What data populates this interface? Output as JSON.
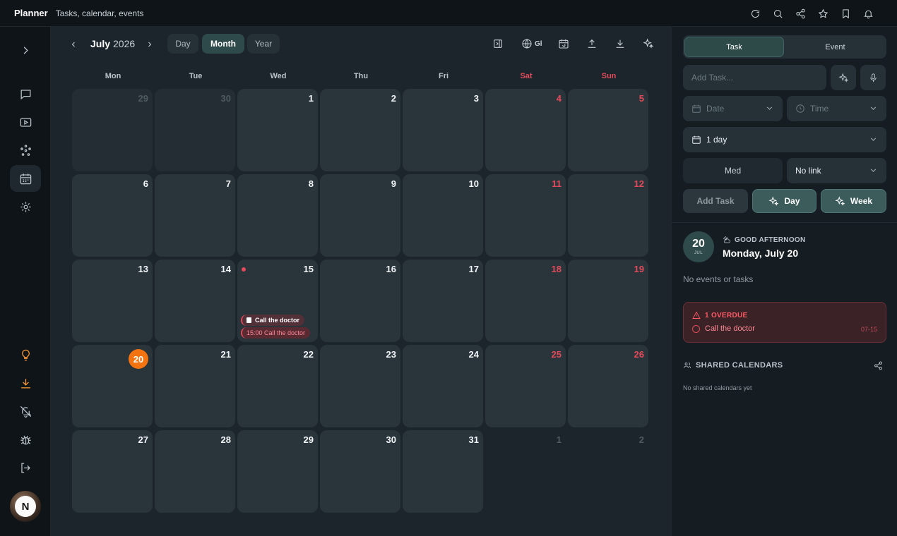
{
  "app": {
    "title": "Planner",
    "subtitle": "Tasks, calendar, events"
  },
  "top_icons": [
    "refresh-icon",
    "search-icon",
    "share-icon",
    "star-icon",
    "bookmark-icon",
    "bell-icon"
  ],
  "sidebar": {
    "items": [
      {
        "name": "expand-icon"
      },
      {
        "name": "chat-icon"
      },
      {
        "name": "video-icon"
      },
      {
        "name": "network-icon"
      },
      {
        "name": "calendar-icon",
        "active": true
      },
      {
        "name": "settings-icon"
      },
      {
        "name": "lightbulb-icon",
        "accent": "#ff9b2f"
      },
      {
        "name": "download-icon",
        "accent": "#ff9b2f"
      },
      {
        "name": "bell-off-icon"
      },
      {
        "name": "bug-icon"
      },
      {
        "name": "logout-icon"
      }
    ],
    "avatar_letter": "N"
  },
  "calendar": {
    "month": "July",
    "year": "2026",
    "views": [
      "Day",
      "Month",
      "Year"
    ],
    "active_view": "Month",
    "globe_label": "Gl",
    "weekdays": [
      "Mon",
      "Tue",
      "Wed",
      "Thu",
      "Fri",
      "Sat",
      "Sun"
    ],
    "weeks": [
      [
        "29",
        "30",
        "1",
        "2",
        "3",
        "4",
        "5"
      ],
      [
        "6",
        "7",
        "8",
        "9",
        "10",
        "11",
        "12"
      ],
      [
        "13",
        "14",
        "15",
        "16",
        "17",
        "18",
        "19"
      ],
      [
        "20",
        "21",
        "22",
        "23",
        "24",
        "25",
        "26"
      ],
      [
        "27",
        "28",
        "29",
        "30",
        "31",
        "1",
        "2"
      ]
    ],
    "today": "20",
    "events_on_15": {
      "task": "Call the doctor",
      "event": "15:00 Call the doctor"
    }
  },
  "panel": {
    "tabs": [
      "Task",
      "Event"
    ],
    "active_tab": "Task",
    "add_placeholder": "Add Task...",
    "date_placeholder": "Date",
    "time_placeholder": "Time",
    "duration": "1 day",
    "priority": "Med",
    "link": "No link",
    "add_button": "Add Task",
    "day_button": "Day",
    "week_button": "Week",
    "date_num": "20",
    "date_month": "JUL",
    "greeting": "GOOD AFTERNOON",
    "full_date": "Monday, July 20",
    "no_events": "No events or tasks",
    "overdue_title": "1 OVERDUE",
    "overdue_item": "Call the doctor",
    "overdue_date": "07-15",
    "shared_title": "SHARED CALENDARS",
    "no_shared": "No shared calendars yet"
  },
  "colors": {
    "accent": "#2f4a4a",
    "today": "#f2730f",
    "weekend": "#e34a5a"
  }
}
